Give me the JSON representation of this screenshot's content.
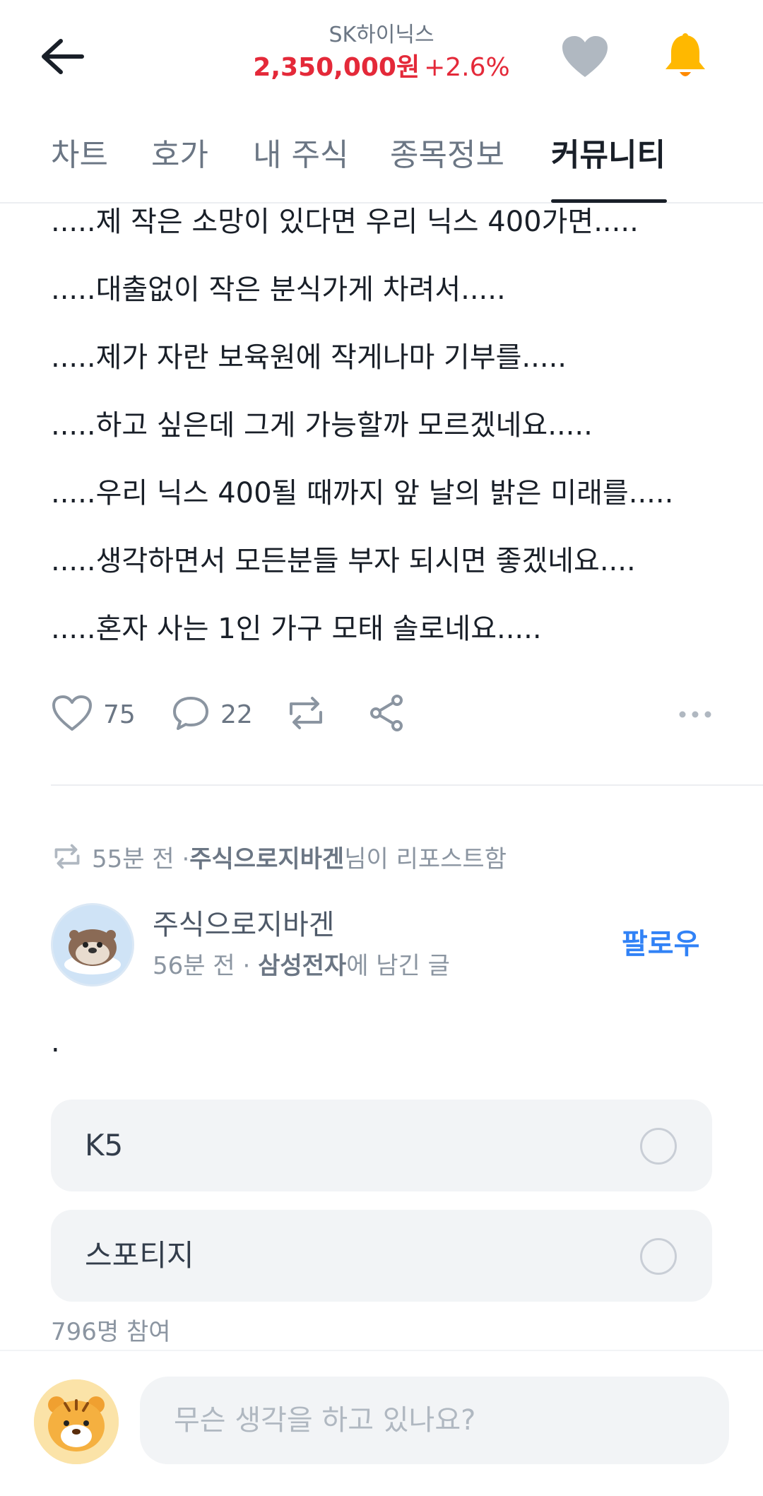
{
  "header": {
    "stock_name": "SK하이닉스",
    "price": "2,350,000원",
    "change": "+2.6%",
    "price_color": "#e42939",
    "bell_color": "#ffb800",
    "heart_color": "#b0b8c1"
  },
  "tabs": [
    {
      "label": "차트"
    },
    {
      "label": "호가"
    },
    {
      "label": "내 주식"
    },
    {
      "label": "종목정보"
    },
    {
      "label": "커뮤니티",
      "active": true
    }
  ],
  "post": {
    "lines": [
      ".....제 작은 소망이 있다면 우리 닉스 400가면.....",
      ".....대출없이 작은 분식가게 차려서.....",
      ".....제가 자란 보육원에 작게나마 기부를.....",
      ".....하고 싶은데 그게 가능할까 모르겠네요.....",
      ".....우리 닉스 400될 때까지 앞 날의 밝은 미래를.....",
      ".....생각하면서 모든분들 부자 되시면 좋겠네요....",
      ".....혼자 사는 1인 가구 모태 솔로네요....."
    ],
    "likes": "75",
    "comments": "22"
  },
  "repost": {
    "time": "55분 전 · ",
    "user": "주식으로지바겐",
    "suffix": "님이 리포스트함"
  },
  "author": {
    "name": "주식으로지바겐",
    "time": "56분 전 · ",
    "stock": "삼성전자",
    "suffix": "에 남긴 글",
    "follow_label": "팔로우"
  },
  "second_post": {
    "text": "."
  },
  "poll": {
    "options": [
      "K5",
      "스포티지"
    ],
    "participants": "796명 참여"
  },
  "composer": {
    "placeholder": "무슨 생각을 하고 있나요?"
  },
  "icons": {
    "back": "arrow-left-icon",
    "heart": "heart-icon",
    "bell": "bell-icon",
    "like": "heart-outline-icon",
    "comment": "comment-icon",
    "repost": "repost-icon",
    "share": "share-icon",
    "more": "more-horizontal-icon"
  }
}
